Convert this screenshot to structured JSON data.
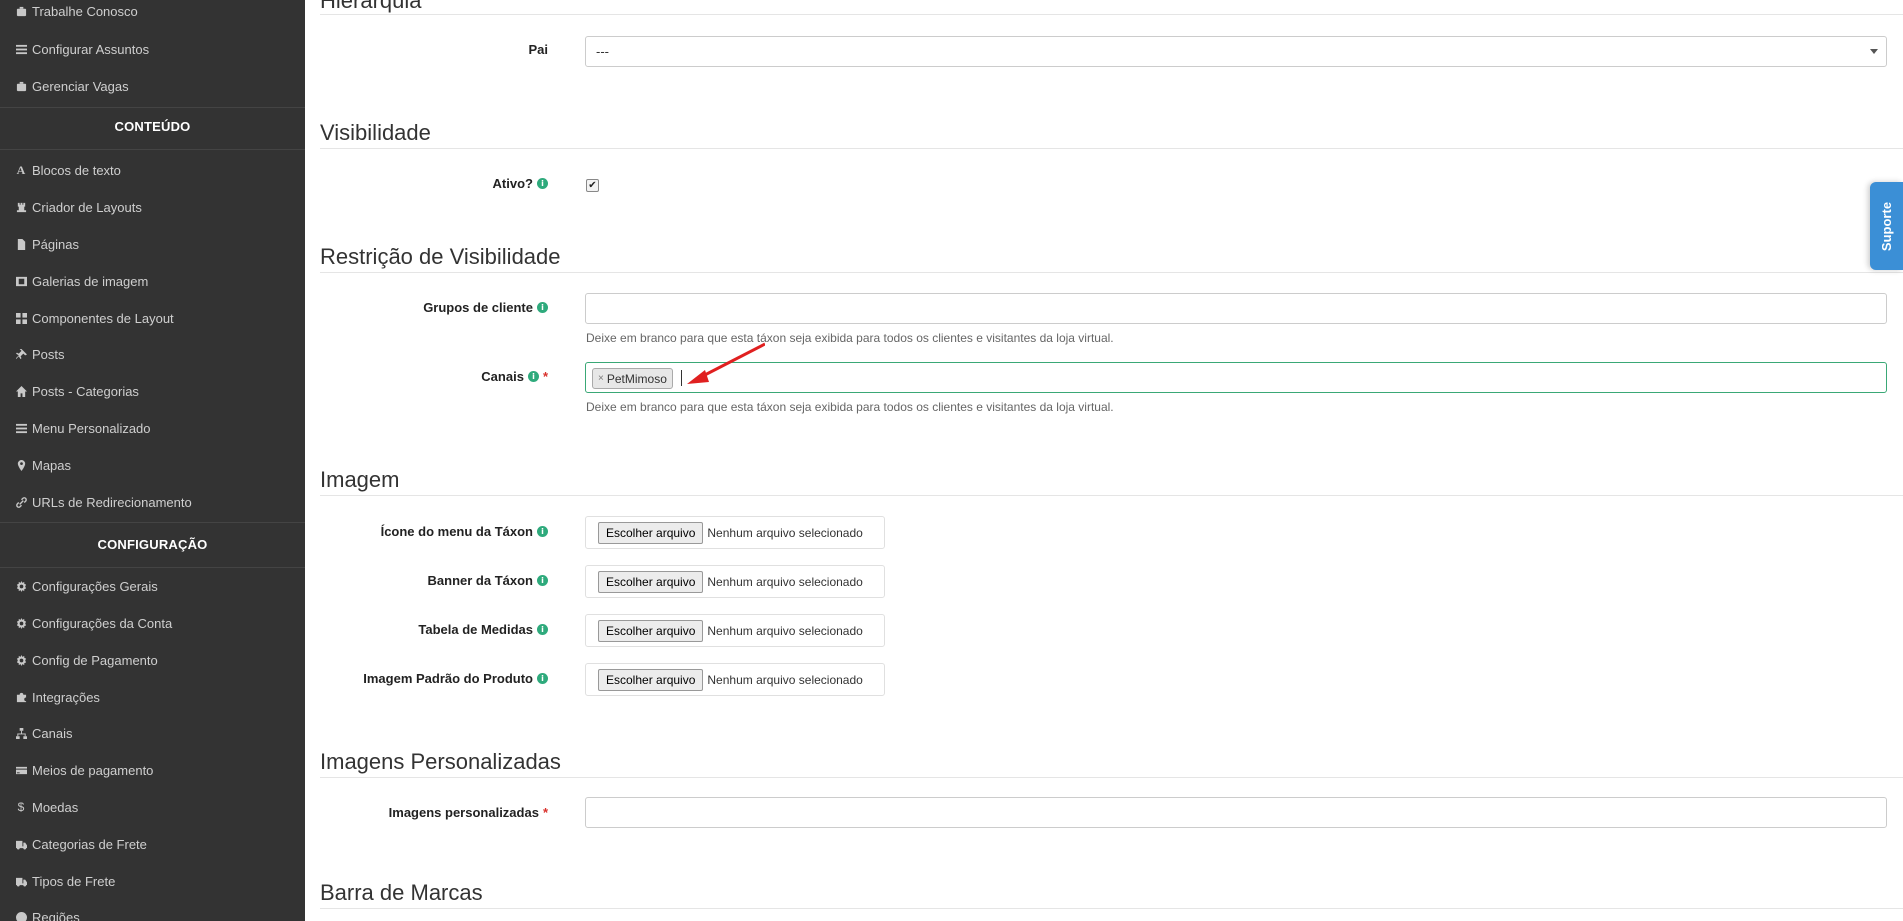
{
  "sidebar": {
    "items_top": [
      {
        "label": "Trabalhe Conosco",
        "icon": "briefcase-icon"
      },
      {
        "label": "Configurar Assuntos",
        "icon": "list-icon"
      },
      {
        "label": "Gerenciar Vagas",
        "icon": "briefcase-icon"
      }
    ],
    "section_conteudo": "CONTEÚDO",
    "items_conteudo": [
      {
        "label": "Blocos de texto",
        "icon": "font-icon"
      },
      {
        "label": "Criador de Layouts",
        "icon": "chess-rook-icon"
      },
      {
        "label": "Páginas",
        "icon": "file-icon"
      },
      {
        "label": "Galerias de imagem",
        "icon": "film-icon"
      },
      {
        "label": "Componentes de Layout",
        "icon": "th-large-icon"
      },
      {
        "label": "Posts",
        "icon": "pin-icon"
      },
      {
        "label": "Posts - Categorias",
        "icon": "home-icon"
      },
      {
        "label": "Menu Personalizado",
        "icon": "list-icon"
      },
      {
        "label": "Mapas",
        "icon": "map-marker-icon"
      },
      {
        "label": "URLs de Redirecionamento",
        "icon": "link-icon"
      }
    ],
    "section_config": "CONFIGURAÇÃO",
    "items_config": [
      {
        "label": "Configurações Gerais",
        "icon": "gear-icon"
      },
      {
        "label": "Configurações da Conta",
        "icon": "gear-icon"
      },
      {
        "label": "Config de Pagamento",
        "icon": "gear-icon"
      },
      {
        "label": "Integrações",
        "icon": "puzzle-icon"
      },
      {
        "label": "Canais",
        "icon": "sitemap-icon"
      },
      {
        "label": "Meios de pagamento",
        "icon": "credit-card-icon"
      },
      {
        "label": "Moedas",
        "icon": "dollar-icon"
      },
      {
        "label": "Categorias de Frete",
        "icon": "truck-icon"
      },
      {
        "label": "Tipos de Frete",
        "icon": "truck-icon"
      },
      {
        "label": "Regiões",
        "icon": "globe-icon"
      }
    ]
  },
  "main": {
    "hierarquia": {
      "title": "Hierarquia",
      "pai_label": "Pai",
      "pai_value": "---"
    },
    "visibilidade": {
      "title": "Visibilidade",
      "ativo_label": "Ativo?",
      "ativo_checked": "✔"
    },
    "restricao": {
      "title": "Restrição de Visibilidade",
      "grupos_label": "Grupos de cliente",
      "grupos_help": "Deixe em branco para que esta táxon seja exibida para todos os clientes e visitantes da loja virtual.",
      "canais_label": "Canais",
      "canais_required": "*",
      "canais_tag": "PetMimoso",
      "canais_tag_remove": "×",
      "canais_help": "Deixe em branco para que esta táxon seja exibida para todos os clientes e visitantes da loja virtual."
    },
    "imagem": {
      "title": "Imagem",
      "button_label": "Escolher arquivo",
      "no_file": "Nenhum arquivo selecionado",
      "fields": [
        {
          "label": "Ícone do menu da Táxon"
        },
        {
          "label": "Banner da Táxon"
        },
        {
          "label": "Tabela de Medidas"
        },
        {
          "label": "Imagem Padrão do Produto"
        }
      ]
    },
    "personalizadas": {
      "title": "Imagens Personalizadas",
      "label": "Imagens personalizadas",
      "required": "*"
    },
    "barra": {
      "title": "Barra de Marcas"
    }
  },
  "support_tab": "Suporte",
  "colors": {
    "sidebar_bg": "#333333",
    "info_badge": "#2eaa7c",
    "required": "#d9302b",
    "support": "#3b8fd6",
    "arrow": "#e02020",
    "focus_border": "#3aa876"
  }
}
